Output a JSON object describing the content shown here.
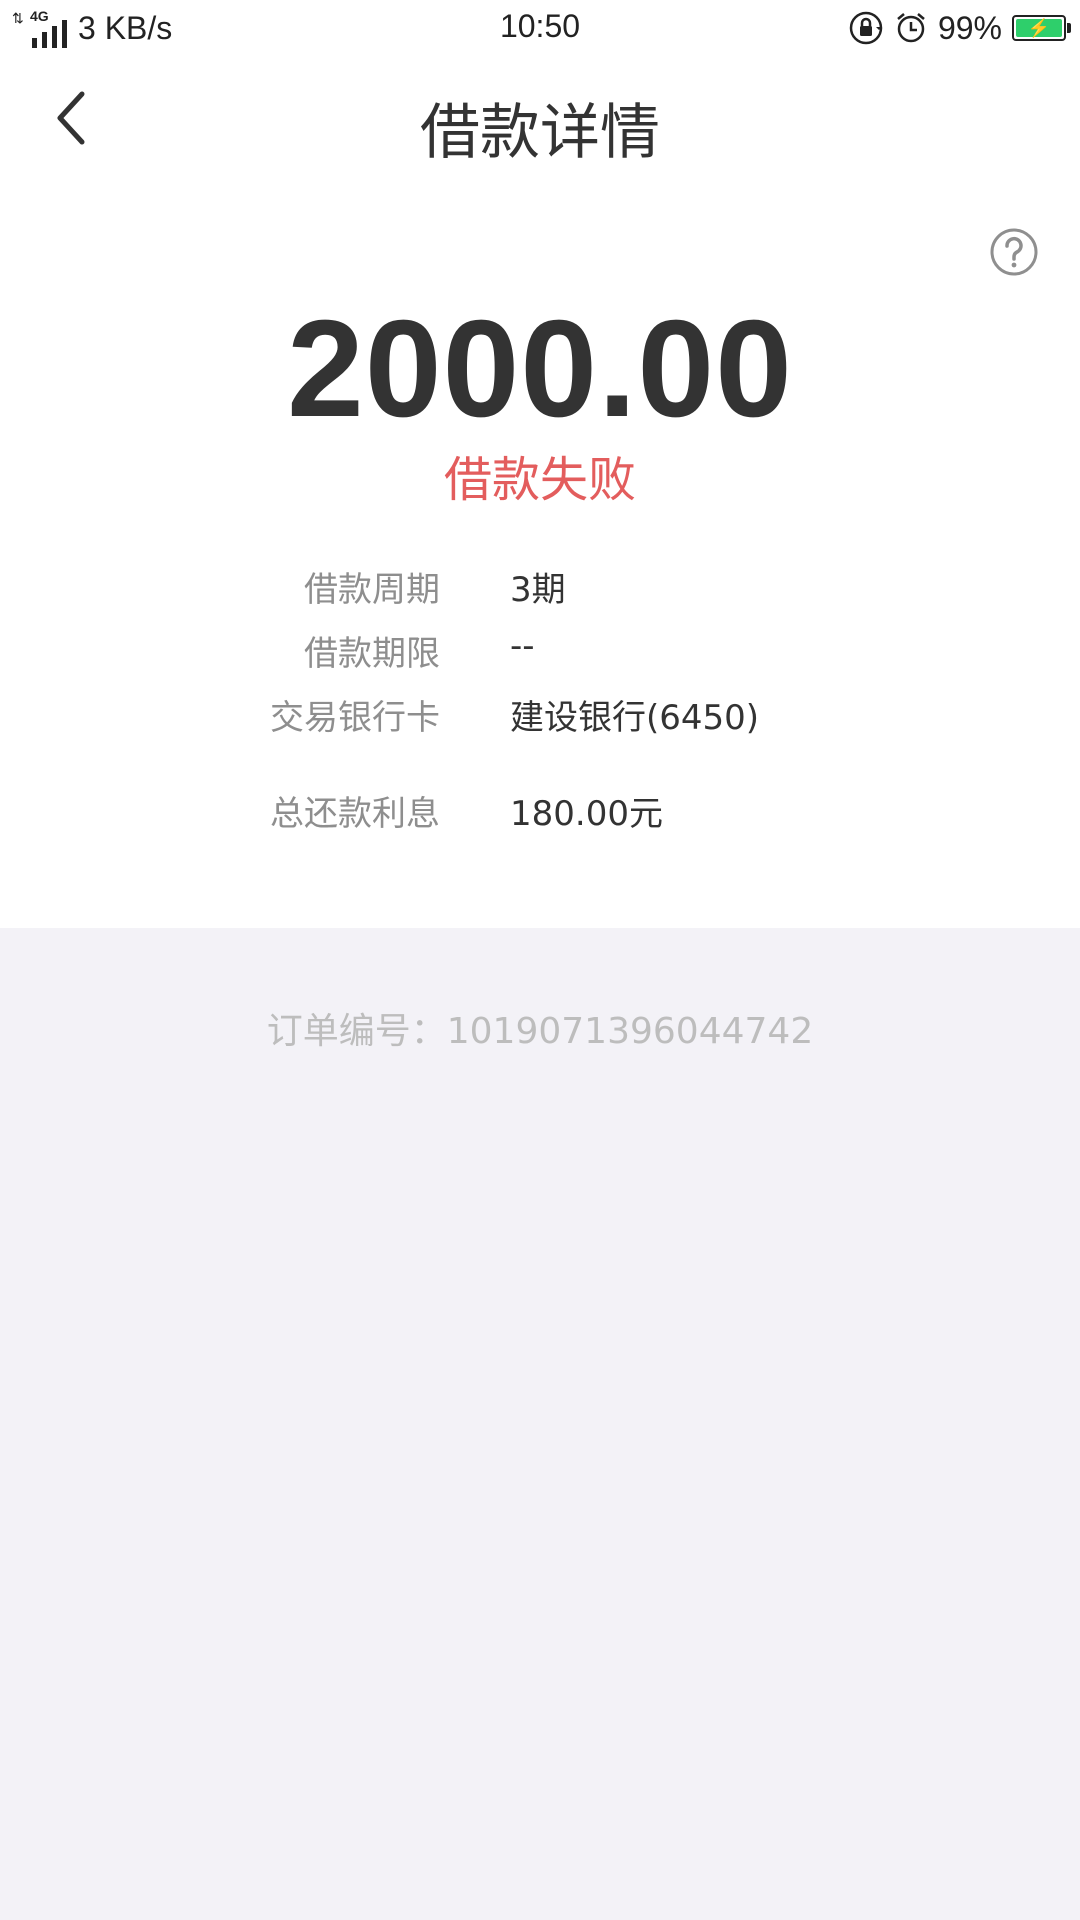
{
  "status_bar": {
    "network_type": "4G",
    "net_speed": "3 KB/s",
    "time": "10:50",
    "battery_percent": "99%",
    "battery_level": 0.99,
    "icons": [
      "orientation-lock-icon",
      "alarm-icon",
      "battery-charging-icon"
    ]
  },
  "nav": {
    "title": "借款详情",
    "back_icon": "chevron-left-icon",
    "help_icon": "question-circle-icon"
  },
  "summary": {
    "amount": "2000.00",
    "status": "借款失败",
    "status_color": "#e35d5d"
  },
  "details": {
    "period_label": "借款周期",
    "period_value": "3期",
    "term_label": "借款期限",
    "term_value": "--",
    "card_label": "交易银行卡",
    "card_value": "建设银行(6450)",
    "interest_label": "总还款利息",
    "interest_value": "180.00元"
  },
  "order": {
    "text": "订单编号：1019071396044742"
  }
}
